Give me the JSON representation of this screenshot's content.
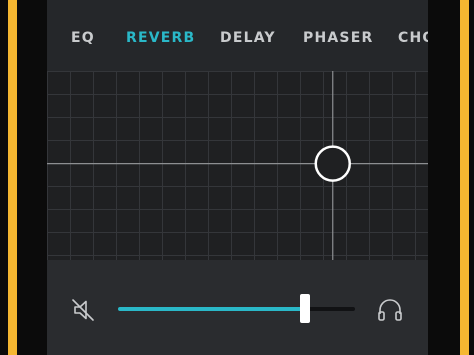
{
  "colors": {
    "accent": "#2ab8c8",
    "frame_accent": "#f5b731",
    "tab_text": "#c9cbcd",
    "pad_background": "#1f2022",
    "grid_line": "#34363a",
    "crosshair": "#8d8f92"
  },
  "tabs": {
    "items": [
      {
        "label": "EQ",
        "active": false
      },
      {
        "label": "REVERB",
        "active": true
      },
      {
        "label": "DELAY",
        "active": false
      },
      {
        "label": "PHASER",
        "active": false
      },
      {
        "label": "CHO",
        "active": false
      }
    ]
  },
  "xy_pad": {
    "x_value": 0.75,
    "y_value": 0.49
  },
  "controls": {
    "mute_icon": "speaker-muted-icon",
    "headphones_icon": "headphones-icon",
    "volume_level": 0.79
  }
}
